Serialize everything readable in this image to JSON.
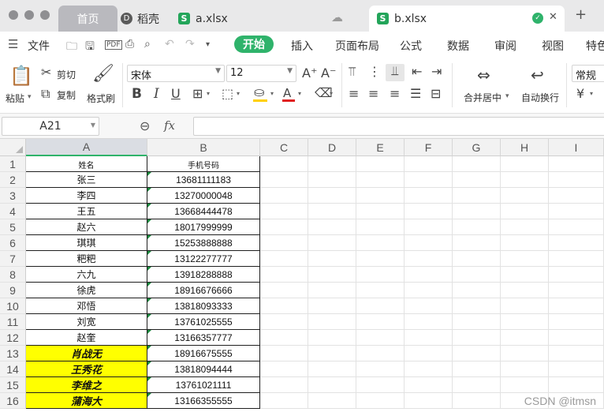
{
  "window": {
    "tabs": [
      {
        "label": "首页",
        "state": "home"
      },
      {
        "label": "稻壳",
        "state": "inactive"
      },
      {
        "label": "a.xlsx",
        "state": "inactive"
      },
      {
        "label": "b.xlsx",
        "state": "active"
      }
    ],
    "new_tab_symbol": "+",
    "close_symbol": "✕"
  },
  "menu": {
    "file_label": "文件",
    "items": [
      "开始",
      "插入",
      "页面布局",
      "公式",
      "数据",
      "审阅",
      "视图",
      "特色"
    ],
    "active_item": "开始"
  },
  "ribbon": {
    "paste_label": "粘贴",
    "cut_label": "剪切",
    "copy_label": "复制",
    "format_painter_label": "格式刷",
    "font_name": "宋体",
    "font_size": "12",
    "merge_label": "合并居中",
    "wrap_label": "自动换行",
    "number_format": "常规",
    "accent_color": "#2fb36b",
    "font_color": "#e02020",
    "fill_color": "#ffd000"
  },
  "formula_bar": {
    "cell_ref": "A21",
    "fx_label": "fx",
    "value": ""
  },
  "sheet": {
    "columns": [
      "A",
      "B",
      "C",
      "D",
      "E",
      "F",
      "G",
      "H",
      "I"
    ],
    "selected_column": "A",
    "headers": {
      "name": "姓名",
      "phone": "手机号码"
    },
    "rows": [
      {
        "row": "1",
        "name": "姓名",
        "phone": "手机号码",
        "highlight": false
      },
      {
        "row": "2",
        "name": "张三",
        "phone": "13681111183",
        "highlight": false
      },
      {
        "row": "3",
        "name": "李四",
        "phone": "13270000048",
        "highlight": false
      },
      {
        "row": "4",
        "name": "王五",
        "phone": "13668444478",
        "highlight": false
      },
      {
        "row": "5",
        "name": "赵六",
        "phone": "18017999999",
        "highlight": false
      },
      {
        "row": "6",
        "name": "琪琪",
        "phone": "15253888888",
        "highlight": false
      },
      {
        "row": "7",
        "name": "粑粑",
        "phone": "13122277777",
        "highlight": false
      },
      {
        "row": "8",
        "name": "六九",
        "phone": "13918288888",
        "highlight": false
      },
      {
        "row": "9",
        "name": "徐虎",
        "phone": "18916676666",
        "highlight": false
      },
      {
        "row": "10",
        "name": "邓悟",
        "phone": "13818093333",
        "highlight": false
      },
      {
        "row": "11",
        "name": "刘宽",
        "phone": "13761025555",
        "highlight": false
      },
      {
        "row": "12",
        "name": "赵奎",
        "phone": "13166357777",
        "highlight": false
      },
      {
        "row": "13",
        "name": "肖战无",
        "phone": "18916675555",
        "highlight": true
      },
      {
        "row": "14",
        "name": "王秀花",
        "phone": "13818094444",
        "highlight": true
      },
      {
        "row": "15",
        "name": "李维之",
        "phone": "13761021111",
        "highlight": true
      },
      {
        "row": "16",
        "name": "蒲海大",
        "phone": "13166355555",
        "highlight": true
      }
    ],
    "highlight_color": "#ffff00"
  },
  "watermark": "CSDN @itmsn"
}
